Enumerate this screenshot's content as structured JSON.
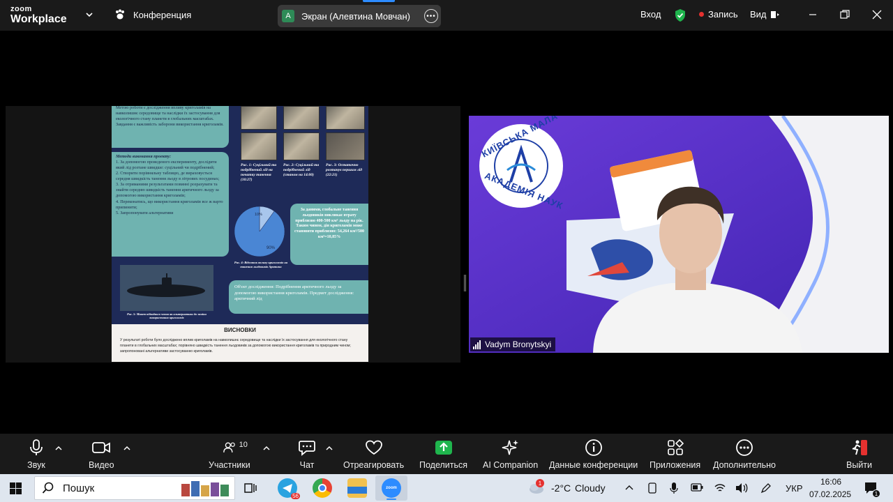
{
  "topbar": {
    "brand_line1": "zoom",
    "brand_line2": "Workplace",
    "meeting_label": "Конференция",
    "share_avatar": "А",
    "share_label": "Экран (Алевтина Мовчан)",
    "signin": "Вход",
    "record": "Запись",
    "view": "Вид",
    "colors": {
      "bar": "#1a1a1a",
      "shield": "#1fb54d",
      "record": "#e5312f"
    }
  },
  "slide": {
    "box1": "Метою роботи є дослідження впливу криголамів на навколишнє середовище та наслідки їх застосування для екологічного стану планети в глобальних масштабах. Завдання є важливість заборони використання криголамів.",
    "methods_title": "Методи виконання проекту:",
    "methods": [
      "1. За допомогою проведеного експерименту, дослідити який лід розтане швидше: суцільний чи подрібнений;",
      "2. Створити порівняльну таблицю, де вираховується середня швидкість танення льоду в літрових посудинах;",
      "3. За отриманими результатами повинні розрахувати та знайти середню швидкість танення арктичного льоду за допомогою використання криголамів;",
      "4. Переконатись, що використання криголамів все ж варто припинити;",
      "5. Запропонувати альтернативи"
    ],
    "captions": [
      "Рис. 1: Суцільний та подрібнений лід на початку танення (10:27)",
      "Рис. 2: Суцільний та подрібнений лід (станом на 14:00)",
      "Рис. 3: Остаточно розтанув першим лід (22:21)"
    ],
    "pie_small_label": "10%",
    "pie_big_label": "90%",
    "pie_caption": "Рис. 4: Відсоток впливу криголамів на танення льодовиків Арктики",
    "result_box": "За даними, глобальне танення льодовиків викликає втрату приблизно 400-500 км³ льоду на рік. Таким чином, дія криголамів може становити приблизно: 54,264 км³/500 км³=10,85%",
    "sub_caption": "Рис. 5: Макет підводного човна як альтернативи до заміни використання криголамів",
    "object_box": "Об'єкт дослідження: Подрібнення арктичного льоду за допомогою використання криголамів. Предмет дослідження: арктичний лід",
    "conclusions_title": "ВИСНОВКИ",
    "conclusions_text": "У результаті роботи було досліджено вплив криголамів на навколишнє середовище та наслідки їх застосування для екологічного стану планети в глобальних масштабах; порівняно швидкість танення льодовиків за допомогою використання криголамів та природним чином; запропоновані альтернативи застосуванню криголамів."
  },
  "chart_data": {
    "type": "pie",
    "categories": [
      "10%",
      "90%"
    ],
    "values": [
      10,
      90
    ],
    "title": ""
  },
  "video": {
    "logo_line1": "КИЇВСЬКА МАЛА",
    "logo_line2": "АКАДЕМІЯ НАУК",
    "participant_name": "Vadym Bronytskyi"
  },
  "toolbar": {
    "audio": "Звук",
    "video": "Видео",
    "participants": "Участники",
    "participants_count": "10",
    "chat": "Чат",
    "react": "Отреагировать",
    "share": "Поделиться",
    "ai": "AI Companion",
    "info": "Данные конференции",
    "apps": "Приложения",
    "more": "Дополнительно",
    "leave": "Выйти",
    "colors": {
      "share": "#1fb54d",
      "leave": "#e5312f"
    }
  },
  "taskbar": {
    "search_placeholder": "Пошук",
    "weather_temp": "-2°C",
    "weather_text": "Cloudy",
    "weather_badge": "1",
    "telegram_badge": "56",
    "lang": "УКР",
    "time": "16:06",
    "date": "07.02.2025",
    "notify_badge": "1"
  }
}
